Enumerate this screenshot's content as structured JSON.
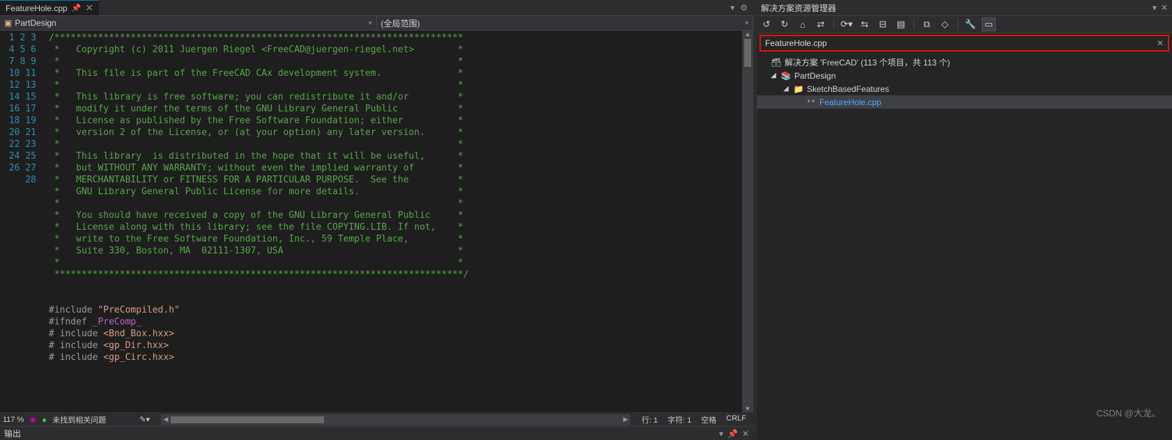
{
  "tab": {
    "title": "FeatureHole.cpp",
    "pin_icon": "pin-icon",
    "close_icon": "close-icon"
  },
  "tab_actions": {
    "dropdown_icon": "▾",
    "gear_icon": "⚙"
  },
  "navbar": {
    "scope_icon": "class-icon",
    "scope_label": "PartDesign",
    "func_label": "(全局范围)"
  },
  "code_lines": [
    "/***************************************************************************",
    " *   Copyright (c) 2011 Juergen Riegel <FreeCAD@juergen-riegel.net>        *",
    " *                                                                         *",
    " *   This file is part of the FreeCAD CAx development system.              *",
    " *                                                                         *",
    " *   This library is free software; you can redistribute it and/or         *",
    " *   modify it under the terms of the GNU Library General Public           *",
    " *   License as published by the Free Software Foundation; either          *",
    " *   version 2 of the License, or (at your option) any later version.      *",
    " *                                                                         *",
    " *   This library  is distributed in the hope that it will be useful,      *",
    " *   but WITHOUT ANY WARRANTY; without even the implied warranty of        *",
    " *   MERCHANTABILITY or FITNESS FOR A PARTICULAR PURPOSE.  See the         *",
    " *   GNU Library General Public License for more details.                  *",
    " *                                                                         *",
    " *   You should have received a copy of the GNU Library General Public     *",
    " *   License along with this library; see the file COPYING.LIB. If not,    *",
    " *   write to the Free Software Foundation, Inc., 59 Temple Place,         *",
    " *   Suite 330, Boston, MA  02111-1307, USA                                *",
    " *                                                                         *",
    " ***************************************************************************/",
    "",
    ""
  ],
  "include_lines": [
    {
      "directive": "#include ",
      "arg": "\"PreCompiled.h\"",
      "cls": "str"
    },
    {
      "directive": "#ifndef ",
      "arg": "_PreComp_",
      "cls": "mac"
    },
    {
      "directive": "# include ",
      "arg": "<Bnd_Box.hxx>",
      "cls": "str"
    },
    {
      "directive": "# include ",
      "arg": "<gp_Dir.hxx>",
      "cls": "str"
    },
    {
      "directive": "# include ",
      "arg": "<gp_Circ.hxx>",
      "cls": "str"
    }
  ],
  "line_start": 1,
  "line_end": 28,
  "status": {
    "zoom": "117 %",
    "issue_icon": "●",
    "issue_text": "未找到相关问题",
    "brush_icon": "✎▾",
    "line_label": "行: 1",
    "char_label": "字符: 1",
    "space_label": "空格",
    "crlf_label": "CRLF"
  },
  "solution_explorer": {
    "title": "解决方案资源管理器",
    "search_value": "FeatureHole.cpp",
    "toolbar_icons": [
      "back-icon",
      "forward-icon",
      "home-icon",
      "switch-view-icon",
      "sync-icon",
      "refresh-icon",
      "collapse-icon",
      "show-all-icon",
      "properties-icon",
      "preview-icon",
      "wrench-icon",
      "filter-icon"
    ],
    "tree": [
      {
        "depth": 0,
        "exp": "",
        "icon": "🗃",
        "label": "解决方案 'FreeCAD' (113 个项目，共 113 个)",
        "selected": false
      },
      {
        "depth": 1,
        "exp": "◢",
        "icon": "📚",
        "label": "PartDesign",
        "selected": false
      },
      {
        "depth": 2,
        "exp": "◢",
        "icon": "📁",
        "label": "SketchBasedFeatures",
        "selected": false
      },
      {
        "depth": 3,
        "exp": "",
        "icon": "⁺⁺",
        "label": "FeatureHole.cpp",
        "selected": true
      }
    ]
  },
  "output": {
    "title": "输出",
    "dropdown_icon": "▾",
    "pin_icon": "📌",
    "close_icon": "✕"
  },
  "watermark": "CSDN @大龙。"
}
